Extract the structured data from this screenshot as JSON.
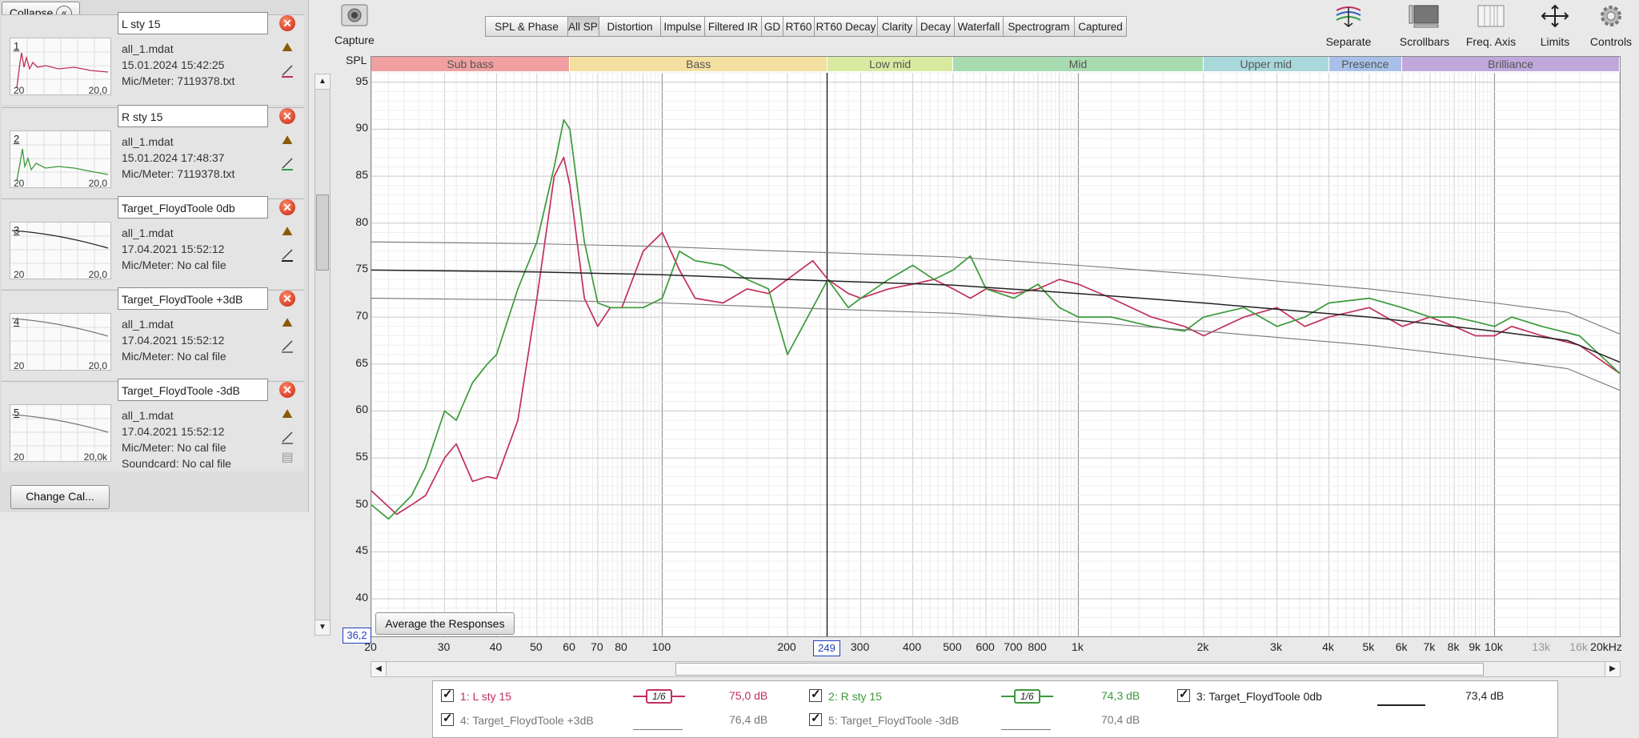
{
  "left": {
    "collapse_label": "Collapse",
    "change_cal_label": "Change Cal...",
    "measurements": [
      {
        "num": "1",
        "name": "L sty 15",
        "file": "all_1.mdat",
        "date": "15.01.2024 15:42:25",
        "mic": "Mic/Meter: 7119378.txt",
        "color": "#c0305a",
        "x_min": "20",
        "x_max": "20,0"
      },
      {
        "num": "2",
        "name": "R sty 15",
        "file": "all_1.mdat",
        "date": "15.01.2024 17:48:37",
        "mic": "Mic/Meter: 7119378.txt",
        "color": "#3a9a3a",
        "x_min": "20",
        "x_max": "20,0"
      },
      {
        "num": "3",
        "name": "Target_FloydToole 0db",
        "file": "all_1.mdat",
        "date": "17.04.2021 15:52:12",
        "mic": "Mic/Meter: No cal file",
        "color": "#222222",
        "x_min": "20",
        "x_max": "20,0"
      },
      {
        "num": "4",
        "name": "Target_FloydToole +3dB",
        "file": "all_1.mdat",
        "date": "17.04.2021 15:52:12",
        "mic": "Mic/Meter: No cal file",
        "color": "#777777",
        "x_min": "20",
        "x_max": "20,0"
      },
      {
        "num": "5",
        "name": "Target_FloydToole -3dB",
        "file": "all_1.mdat",
        "date": "17.04.2021 15:52:12",
        "mic": "Mic/Meter: No cal file",
        "soundcard": "Soundcard: No cal file",
        "color": "#777777",
        "x_min": "20",
        "x_max": "20,0k"
      }
    ]
  },
  "toolbar": {
    "capture_label": "Capture",
    "tabs": [
      "SPL & Phase",
      "All SPL",
      "Distortion",
      "Impulse",
      "Filtered IR",
      "GD",
      "RT60",
      "RT60 Decay",
      "Clarity",
      "Decay",
      "Waterfall",
      "Spectrogram",
      "Captured"
    ],
    "active_tab": "All SPL",
    "tools": [
      "Separate",
      "Scrollbars",
      "Freq. Axis",
      "Limits",
      "Controls"
    ]
  },
  "plot": {
    "y_title": "SPL",
    "bands": [
      {
        "label": "Sub bass",
        "color": "#f0a0a0"
      },
      {
        "label": "Bass",
        "color": "#f4e0a0"
      },
      {
        "label": "Low mid",
        "color": "#d8eaa0"
      },
      {
        "label": "Mid",
        "color": "#a8dcb0"
      },
      {
        "label": "Upper mid",
        "color": "#a8d8dc"
      },
      {
        "label": "Presence",
        "color": "#a8c0e8"
      },
      {
        "label": "Brilliance",
        "color": "#c0a8dc"
      }
    ],
    "cursor_y_readout": "36,2",
    "cursor_x_readout": "249",
    "average_button": "Average the Responses",
    "y_ticks": [
      "95",
      "90",
      "85",
      "80",
      "75",
      "70",
      "65",
      "60",
      "55",
      "50",
      "45",
      "40"
    ],
    "x_ticks": [
      "20",
      "30",
      "40",
      "50",
      "60",
      "70",
      "80",
      "100",
      "200",
      "300",
      "400",
      "500",
      "600",
      "700",
      "800",
      "1k",
      "2k",
      "3k",
      "4k",
      "5k",
      "6k",
      "7k",
      "8k",
      "9k",
      "10k",
      "13k",
      "16k",
      "20kHz"
    ]
  },
  "legend": {
    "row1": [
      {
        "label": "1: L sty 15",
        "smoothing": "1/6",
        "value": "75,0 dB",
        "color": "#c0305a"
      },
      {
        "label": "2: R sty 15",
        "smoothing": "1/6",
        "value": "74,3 dB",
        "color": "#3a9a3a"
      },
      {
        "label": "3: Target_FloydToole 0db",
        "smoothing": "",
        "value": "73,4 dB",
        "color": "#222222"
      }
    ],
    "row2": [
      {
        "label": "4: Target_FloydToole +3dB",
        "value": "76,4 dB",
        "color": "#777777"
      },
      {
        "label": "5: Target_FloydToole -3dB",
        "value": "70,4 dB",
        "color": "#777777"
      }
    ]
  },
  "chart_data": {
    "type": "line",
    "title": "",
    "xlabel": "",
    "ylabel": "SPL",
    "x_scale": "log",
    "xlim": [
      20,
      20000
    ],
    "ylim": [
      36,
      96
    ],
    "grid": true,
    "series": [
      {
        "name": "1: L sty 15",
        "color": "#c0305a",
        "x": [
          20,
          23,
          25,
          27,
          30,
          32,
          35,
          38,
          40,
          45,
          50,
          55,
          58,
          60,
          65,
          70,
          75,
          80,
          90,
          100,
          110,
          120,
          140,
          160,
          180,
          200,
          230,
          250,
          280,
          300,
          350,
          400,
          450,
          500,
          550,
          600,
          700,
          800,
          900,
          1000,
          1200,
          1500,
          1800,
          2000,
          2500,
          3000,
          3500,
          4000,
          5000,
          6000,
          7000,
          8000,
          9000,
          10000,
          11000,
          13000,
          16000,
          20000
        ],
        "y": [
          51.5,
          49,
          50,
          51,
          55,
          56.5,
          52.5,
          53,
          52.8,
          59,
          72,
          85,
          87,
          84,
          72,
          69,
          71,
          71,
          77,
          79,
          75,
          72,
          71.5,
          73,
          72.5,
          74,
          76,
          74,
          72.5,
          72,
          73,
          73.5,
          74,
          73,
          72,
          73,
          72.5,
          73,
          74,
          73.5,
          72,
          70,
          69,
          68,
          70,
          71,
          69,
          70,
          71,
          69,
          70,
          69,
          68,
          68,
          69,
          68,
          67,
          64
        ]
      },
      {
        "name": "2: R sty 15",
        "color": "#3a9a3a",
        "x": [
          20,
          22,
          25,
          27,
          30,
          32,
          35,
          38,
          40,
          45,
          50,
          55,
          58,
          60,
          65,
          70,
          75,
          80,
          90,
          100,
          110,
          120,
          140,
          160,
          180,
          200,
          230,
          250,
          280,
          300,
          350,
          400,
          450,
          500,
          550,
          600,
          700,
          800,
          900,
          1000,
          1200,
          1500,
          1800,
          2000,
          2500,
          3000,
          3500,
          4000,
          5000,
          6000,
          7000,
          8000,
          9000,
          10000,
          11000,
          13000,
          16000,
          20000
        ],
        "y": [
          50,
          48.5,
          51,
          54,
          60,
          59,
          63,
          65,
          66,
          73,
          78,
          86,
          91,
          90,
          78,
          71.5,
          71,
          71,
          71,
          72,
          77,
          76,
          75.5,
          74,
          73,
          66,
          71,
          74,
          71,
          72,
          74,
          75.5,
          74,
          75,
          76.5,
          73,
          72,
          73.5,
          71,
          70,
          70,
          69,
          68.5,
          70,
          71,
          69,
          70,
          71.5,
          72,
          71,
          70,
          70,
          69.5,
          69,
          70,
          69,
          68,
          64
        ]
      },
      {
        "name": "3: Target_FloydToole 0db",
        "color": "#222222",
        "x": [
          20,
          50,
          100,
          200,
          500,
          1000,
          2000,
          5000,
          10000,
          15000,
          20000
        ],
        "y": [
          75,
          74.8,
          74.5,
          74,
          73.4,
          72.5,
          71.5,
          70,
          68.5,
          67.5,
          65.2
        ]
      },
      {
        "name": "4: Target_FloydToole +3dB",
        "color": "#777777",
        "x": [
          20,
          50,
          100,
          200,
          500,
          1000,
          2000,
          5000,
          10000,
          15000,
          20000
        ],
        "y": [
          78,
          77.8,
          77.5,
          77,
          76.4,
          75.5,
          74.5,
          73,
          71.5,
          70.5,
          68.2
        ]
      },
      {
        "name": "5: Target_FloydToole -3dB",
        "color": "#777777",
        "x": [
          20,
          50,
          100,
          200,
          500,
          1000,
          2000,
          5000,
          10000,
          15000,
          20000
        ],
        "y": [
          72,
          71.8,
          71.5,
          71,
          70.4,
          69.5,
          68.5,
          67,
          65.5,
          64.5,
          62.2
        ]
      }
    ]
  }
}
